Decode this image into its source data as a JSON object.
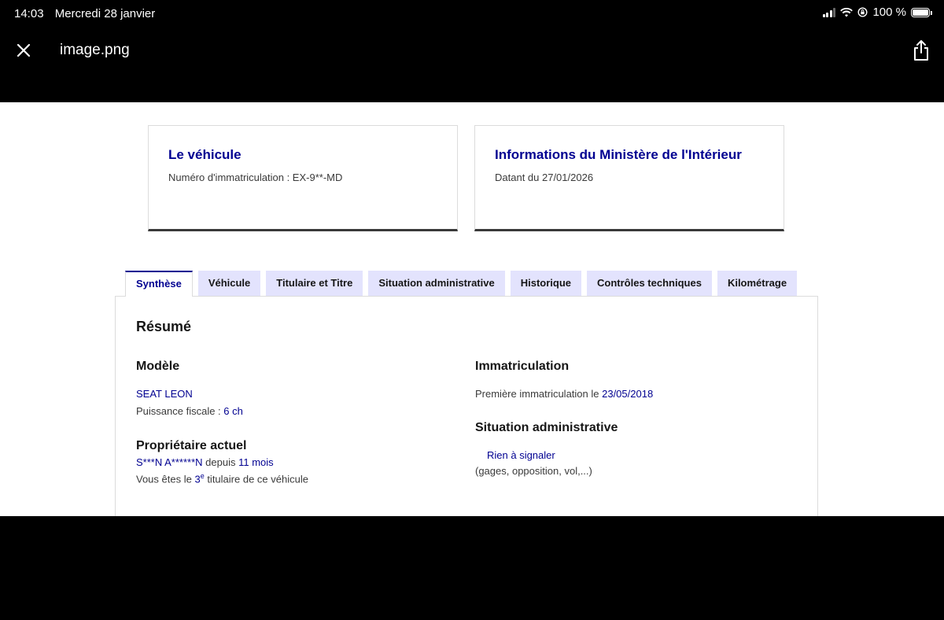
{
  "status_bar": {
    "time": "14:03",
    "date": "Mercredi 28 janvier",
    "battery": "100 %",
    "battery_level": 1.0,
    "icons": [
      "signal-icon",
      "wifi-icon",
      "orientation-lock-icon",
      "battery-icon"
    ]
  },
  "viewer": {
    "file_name": "image.png",
    "close_icon": "close-icon",
    "share_icon": "share-icon"
  },
  "cards": [
    {
      "title": "Le véhicule",
      "subtitle": "Numéro d'immatriculation : EX-9**-MD"
    },
    {
      "title": "Informations du Ministère de l'Intérieur",
      "subtitle": "Datant du 27/01/2026"
    }
  ],
  "tabs": [
    {
      "label": "Synthèse",
      "active": true
    },
    {
      "label": "Véhicule",
      "active": false
    },
    {
      "label": "Titulaire et Titre",
      "active": false
    },
    {
      "label": "Situation administrative",
      "active": false
    },
    {
      "label": "Historique",
      "active": false
    },
    {
      "label": "Contrôles techniques",
      "active": false
    },
    {
      "label": "Kilométrage",
      "active": false
    }
  ],
  "summary": {
    "title": "Résumé",
    "model": {
      "heading": "Modèle",
      "name": "SEAT LEON",
      "power_label": "Puissance fiscale : ",
      "power_value": "6 ch"
    },
    "owner": {
      "heading": "Propriétaire actuel",
      "name": "S***N A******N",
      "since_label": " depuis ",
      "since_value": "11 mois",
      "holder_prefix": "Vous êtes le ",
      "holder_rank": "3",
      "holder_rank_sup": "e",
      "holder_suffix": " titulaire de ce véhicule"
    },
    "registration": {
      "heading": "Immatriculation",
      "first_label": "Première immatriculation le ",
      "first_date": "23/05/2018"
    },
    "admin": {
      "heading": "Situation administrative",
      "status": "Rien à signaler",
      "note": "(gages, opposition, vol,...)"
    }
  },
  "colors": {
    "accent": "#000091",
    "tab_bg": "#e3e3fd",
    "text": "#3a3a3a",
    "background": "#000000"
  }
}
